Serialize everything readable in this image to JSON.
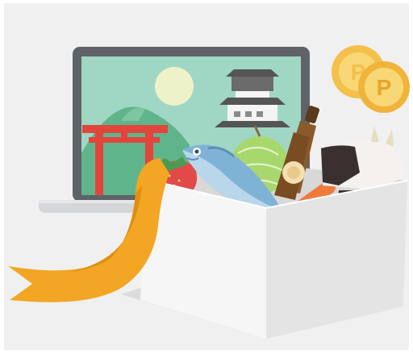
{
  "illustration": {
    "coins": [
      {
        "letter": "P"
      },
      {
        "letter": "P"
      }
    ],
    "colors": {
      "background": "#f0f0f0",
      "laptop_frame": "#5f6266",
      "screen_sky": "#9fd7c4",
      "sun": "#eef2c8",
      "torii": "#e2453c",
      "ribbon": "#f2a623",
      "box": "#ebebeb",
      "coin": "#f4c04c",
      "fish": "#7fb3d6",
      "bottle": "#8a5a2b",
      "cow_black": "#3a3030"
    }
  }
}
